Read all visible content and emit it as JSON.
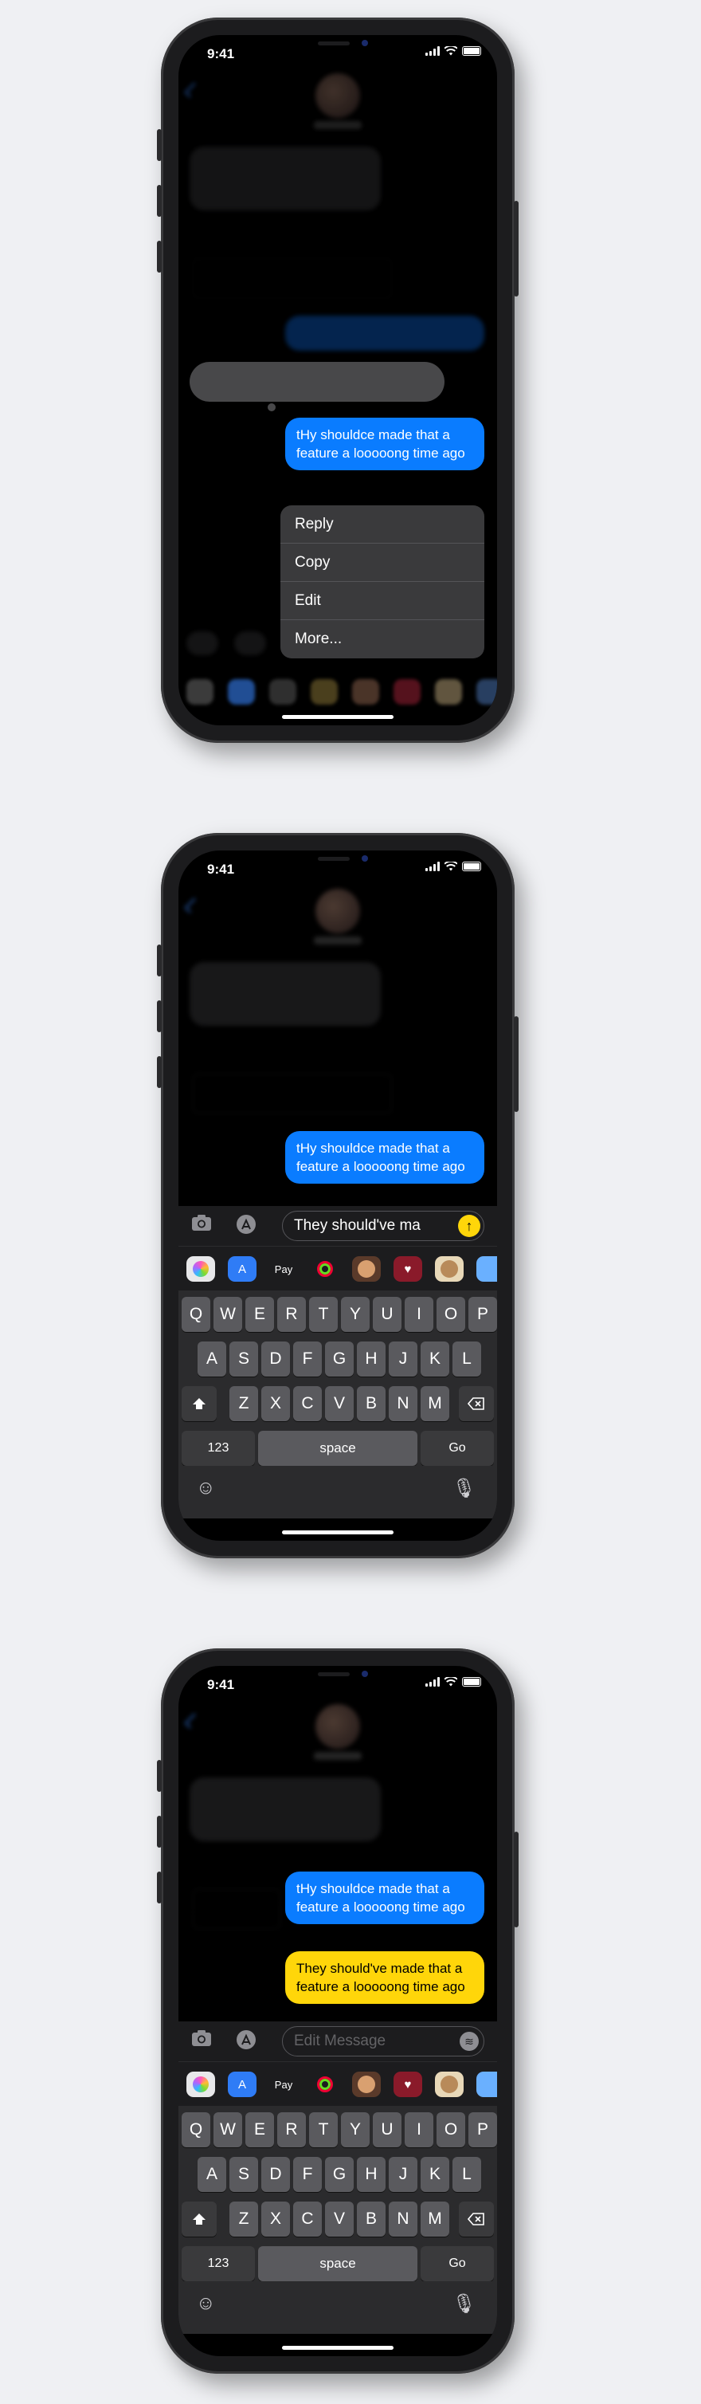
{
  "status": {
    "time": "9:41"
  },
  "messages": {
    "original": "tHy shouldce made that a feature a looooong time ago",
    "edited": "They should've made that a feature a looooong time ago"
  },
  "context_menu": {
    "items": [
      "Reply",
      "Copy",
      "Edit",
      "More..."
    ]
  },
  "input": {
    "editing_value": "They should've ma",
    "placeholder": "Edit Message"
  },
  "apps": [
    "photos-icon",
    "app-store-icon",
    "apple-pay-icon",
    "fitness-icon",
    "memoji-icon",
    "heart-sticker-icon",
    "monkey-memoji-icon",
    "more-apps-icon"
  ],
  "apple_pay_label": "Pay",
  "keyboard": {
    "row1": [
      "Q",
      "W",
      "E",
      "R",
      "T",
      "Y",
      "U",
      "I",
      "O",
      "P"
    ],
    "row2": [
      "A",
      "S",
      "D",
      "F",
      "G",
      "H",
      "J",
      "K",
      "L"
    ],
    "row3": [
      "Z",
      "X",
      "C",
      "V",
      "B",
      "N",
      "M"
    ],
    "numbers": "123",
    "space": "space",
    "go": "Go"
  },
  "colors": {
    "bubble_blue": "#0a7cff",
    "bubble_yellow": "#ffd60a",
    "background": "#eff0f3"
  }
}
